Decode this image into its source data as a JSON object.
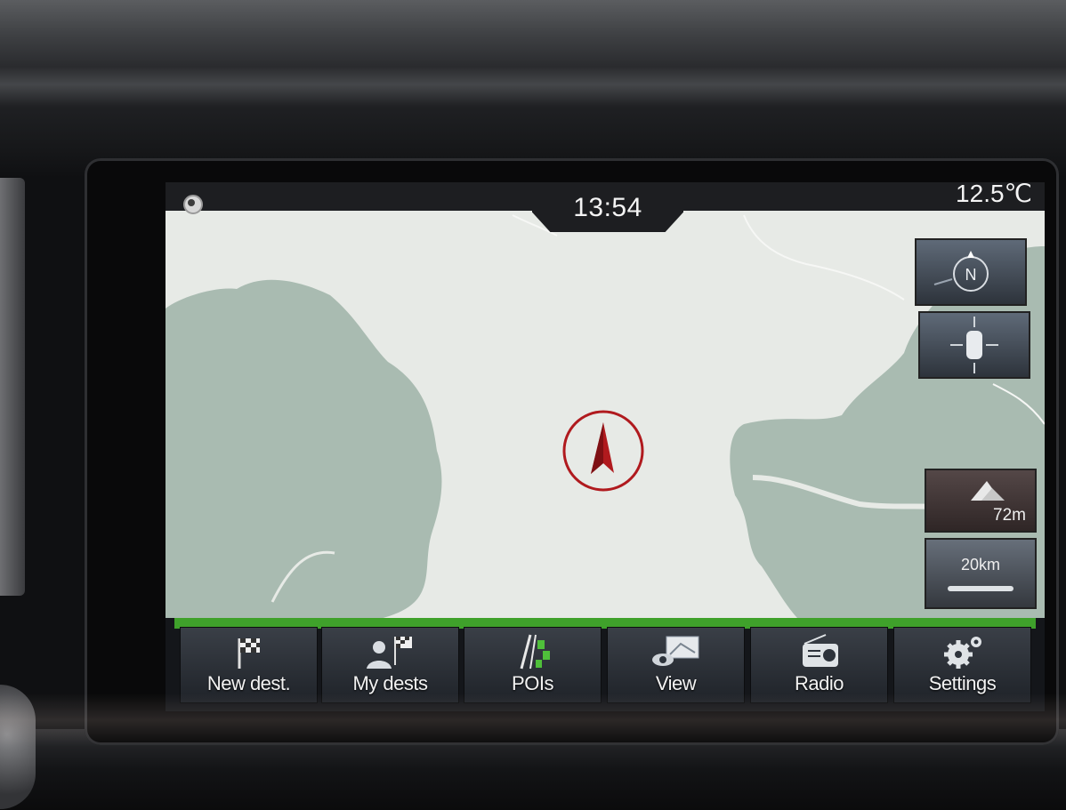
{
  "status_bar": {
    "time": "13:54",
    "temperature": "12.5℃"
  },
  "map_controls": {
    "compass_label": "N",
    "altitude": "72m",
    "scale": "20km"
  },
  "menu": {
    "items": [
      {
        "label": "New dest.",
        "icon": "checkered-flag-icon"
      },
      {
        "label": "My dests",
        "icon": "person-flag-icon"
      },
      {
        "label": "POIs",
        "icon": "poi-road-icon"
      },
      {
        "label": "View",
        "icon": "map-view-icon"
      },
      {
        "label": "Radio",
        "icon": "radio-icon"
      },
      {
        "label": "Settings",
        "icon": "gears-icon"
      }
    ]
  },
  "colors": {
    "accent_green": "#3fa12b",
    "position_marker_red": "#b01a1e",
    "map_background": "#e7eae6",
    "map_land_green": "#a9bbb1"
  }
}
